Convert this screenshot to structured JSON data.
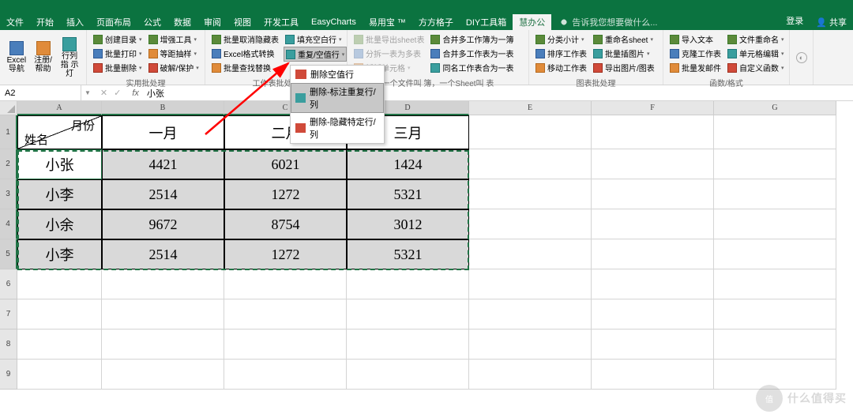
{
  "tabs": {
    "file": "文件",
    "home": "开始",
    "insert": "插入",
    "layout": "页面布局",
    "formula": "公式",
    "data": "数据",
    "review": "审阅",
    "view": "视图",
    "dev": "开发工具",
    "easy": "EasyCharts",
    "yyb": "易用宝 ™",
    "ffz": "方方格子",
    "diy": "DIY工具箱",
    "hbg": "慧办公",
    "login": "登录",
    "share": "共享"
  },
  "tellme": "告诉我您想要做什么...",
  "ribbon": {
    "g1": {
      "b1": "Excel\n导航",
      "b2": "注册/\n帮助",
      "b3": "行列指\n示灯"
    },
    "g2": {
      "label": "实用批处理",
      "r1": "创建目录",
      "r2": "批量打印",
      "r3": "批量删除",
      "c2r1": "增强工具",
      "c2r2": "等距抽样",
      "c2r3": "破解/保护"
    },
    "g3": {
      "label": "工作表批处理",
      "r1": "批量取消隐藏表",
      "r2": "Excel格式转换",
      "r3": "批量查找替换",
      "c2r1": "填充空白行",
      "c2r2": "重复/空值行",
      "c2r3": ""
    },
    "dropdown": {
      "i1": "删除空值行",
      "i2": "删除-标注重复行/列",
      "i3": "删除-隐藏特定行/列"
    },
    "g4": {
      "label": "",
      "r1": "批量导出sheet表",
      "r2": "分拆一表为多表",
      "r3": "拆拆单元格",
      "c2r1": "合并多工作簿为一簿",
      "c2r2": "合并多工作表为一表",
      "c2r3": "同名工作表合为一表",
      "hint": "一个文件叫 簿，一个Sheet叫 表"
    },
    "g5": {
      "label": "图表批处理",
      "r1": "分类小计",
      "r2": "排序工作表",
      "r3": "移动工作表",
      "c2r1": "重命名sheet",
      "c2r2": "批量插图片",
      "c2r3": "导出图片/图表"
    },
    "g6": {
      "label": "函数/格式",
      "r1": "导入文本",
      "r2": "克隆工作表",
      "r3": "批量发邮件",
      "c2r1": "文件重命名",
      "c2r2": "单元格编辑",
      "c2r3": "自定义函数"
    }
  },
  "namebox": "A2",
  "fx": "小张",
  "cols": [
    "A",
    "B",
    "C",
    "D",
    "E",
    "F",
    "G"
  ],
  "rows": [
    "1",
    "2",
    "3",
    "4",
    "5",
    "6",
    "7",
    "8",
    "9"
  ],
  "tableHeader": {
    "diagTop": "月份",
    "diagBot": "姓名",
    "m1": "一月",
    "m2": "二月",
    "m3": "三月"
  },
  "tableData": [
    {
      "name": "小张",
      "m1": "4421",
      "m2": "6021",
      "m3": "1424"
    },
    {
      "name": "小李",
      "m1": "2514",
      "m2": "1272",
      "m3": "5321"
    },
    {
      "name": "小余",
      "m1": "9672",
      "m2": "8754",
      "m3": "3012"
    },
    {
      "name": "小李",
      "m1": "2514",
      "m2": "1272",
      "m3": "5321"
    }
  ],
  "watermark": "什么值得买"
}
